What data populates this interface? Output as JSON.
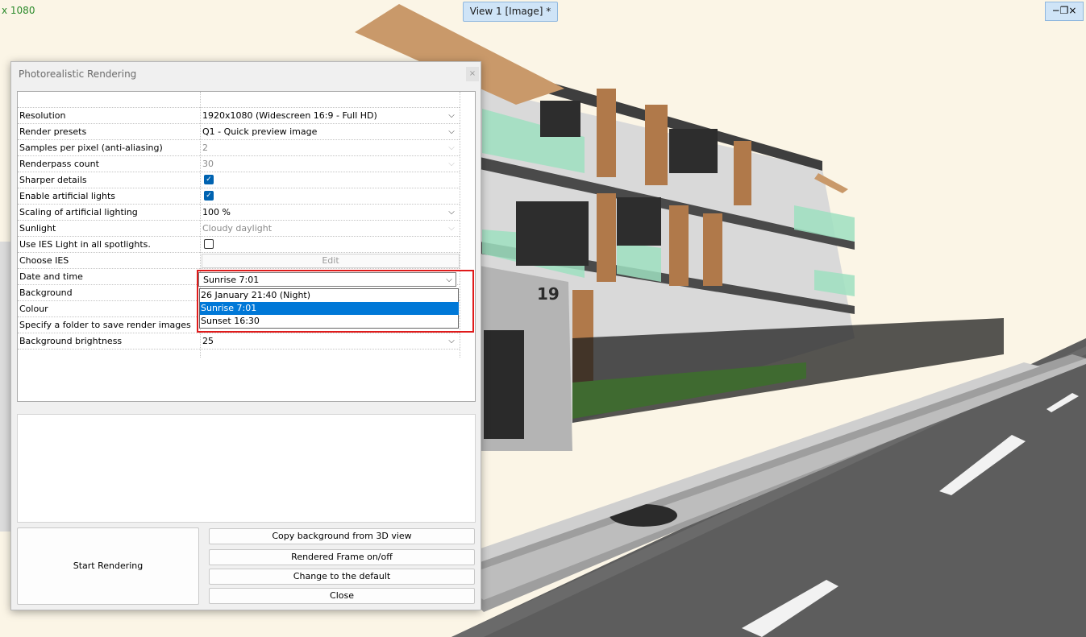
{
  "viewport": {
    "resolution_readout": "x 1080",
    "tab_title": "View 1 [Image] *",
    "window_controls": "−❐×",
    "house_number": "19"
  },
  "dialog": {
    "title": "Photorealistic Rendering",
    "close_glyph": "×",
    "properties": [
      {
        "label": "Resolution",
        "value": "1920x1080 (Widescreen 16:9 - Full HD)"
      },
      {
        "label": "Render presets",
        "value": "Q1 - Quick preview image"
      },
      {
        "label": "Samples per pixel (anti-aliasing)",
        "value": "2"
      },
      {
        "label": "Renderpass count",
        "value": "30"
      },
      {
        "label": "Sharper details",
        "value": "checked"
      },
      {
        "label": "Enable artificial lights",
        "value": "checked"
      },
      {
        "label": "Scaling of artificial lighting",
        "value": "100 %"
      },
      {
        "label": "Sunlight",
        "value": "Cloudy daylight"
      },
      {
        "label": "Use IES Light in all spotlights.",
        "value": "unchecked"
      },
      {
        "label": "Choose IES",
        "value": "Edit"
      },
      {
        "label": "Date and time",
        "value": "Sunrise 7:01"
      },
      {
        "label": "Background",
        "value": ""
      },
      {
        "label": "Colour",
        "value": ""
      },
      {
        "label": "Specify a folder to save render images",
        "value": ""
      },
      {
        "label": "Background brightness",
        "value": "25"
      }
    ],
    "date_dropdown_options": [
      "26 January 21:40  (Night)",
      "Sunrise 7:01",
      "Sunset 16:30"
    ],
    "date_selected_index": 1,
    "buttons": {
      "start": "Start Rendering",
      "copy_bg": "Copy background from 3D view",
      "rendered_frame": "Rendered Frame on/off",
      "default": "Change to the default",
      "close": "Close"
    }
  },
  "colors": {
    "highlight": "#e01b1b",
    "selection": "#0078d7",
    "checkbox": "#0063b1"
  }
}
